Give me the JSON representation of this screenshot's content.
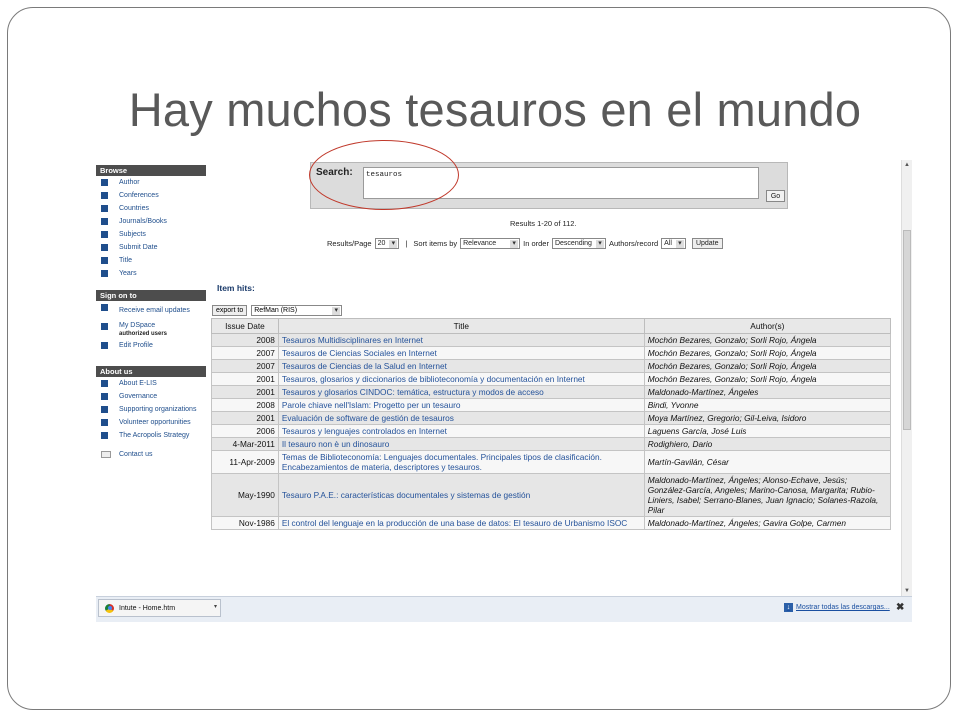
{
  "slide": {
    "title": "Hay muchos tesauros en el mundo"
  },
  "sidebar": {
    "browse_head": "Browse",
    "browse": [
      "Author",
      "Conferences",
      "Countries",
      "Journals/Books",
      "Subjects",
      "Submit Date",
      "Title",
      "Years"
    ],
    "signon_head": "Sign on to",
    "signon": [
      {
        "label": "Receive email updates"
      },
      {
        "label": "My DSpace",
        "sub": "authorized users"
      },
      {
        "label": "Edit Profile"
      }
    ],
    "about_head": "About us",
    "about": [
      "About E-LIS",
      "Governance",
      "Supporting organizations",
      "Volunteer opportunities",
      "The Acropolis Strategy"
    ],
    "contact": "Contact us"
  },
  "search": {
    "label": "Search:",
    "value": "tesauros",
    "go": "Go"
  },
  "results_summary": "Results 1-20 of 112.",
  "controls": {
    "results_per_page_label": "Results/Page",
    "results_per_page": "20",
    "sort_label": "Sort items by",
    "sort_value": "Relevance",
    "order_label": "In order",
    "order_value": "Descending",
    "authors_label": "Authors/record",
    "authors_value": "All",
    "update": "Update"
  },
  "item_hits": "Item hits:",
  "export": {
    "button": "export to",
    "format": "RefMan (RIS)"
  },
  "table": {
    "headers": [
      "Issue Date",
      "Title",
      "Author(s)"
    ],
    "rows": [
      {
        "date": "2008",
        "title": "Tesauros Multidisciplinares en Internet",
        "author": "Mochón Bezares, Gonzalo; Sorli Rojo, Ángela"
      },
      {
        "date": "2007",
        "title": "Tesauros de Ciencias Sociales en Internet",
        "author": "Mochón Bezares, Gonzalo; Sorli Rojo, Ángela"
      },
      {
        "date": "2007",
        "title": "Tesauros de Ciencias de la Salud en Internet",
        "author": "Mochón Bezares, Gonzalo; Sorli Rojo, Ángela"
      },
      {
        "date": "2001",
        "title": "Tesauros, glosarios y diccionarios de biblioteconomía y documentación en Internet",
        "author": "Mochón Bezares, Gonzalo; Sorli Rojo, Ángela"
      },
      {
        "date": "2001",
        "title": "Tesauros y glosarios CINDOC: temática, estructura y modos de acceso",
        "author": "Maldonado-Martínez, Ángeles"
      },
      {
        "date": "2008",
        "title": "Parole chiave nell'Islam: Progetto per un tesauro",
        "author": "Bindi, Yvonne"
      },
      {
        "date": "2001",
        "title": "Evaluación de software de gestión de tesauros",
        "author": "Moya Martínez, Gregorio; Gil-Leiva, Isidoro"
      },
      {
        "date": "2006",
        "title": "Tesauros y lenguajes controlados en Internet",
        "author": "Laguens García, José Luis"
      },
      {
        "date": "4-Mar-2011",
        "title": "Il tesauro non è un dinosauro",
        "author": "Rodighiero, Dario"
      },
      {
        "date": "11-Apr-2009",
        "title": "Temas de Biblioteconomía: Lenguajes documentales. Principales tipos de clasificación. Encabezamientos de materia, descriptores y tesauros.",
        "author": "Martín-Gavilán, César"
      },
      {
        "date": "May-1990",
        "title": "Tesauro P.A.E.: características documentales y sistemas de gestión",
        "author": "Maldonado-Martínez, Ángeles; Alonso-Echave, Jesús; González-García, Angeles; Marino-Canosa, Margarita; Rubio-Liniers, Isabel; Serrano-Blanes, Juan Ignacio; Solanes-Razola, Pilar"
      },
      {
        "date": "Nov-1986",
        "title": "El control del lenguaje en la producción de una base de datos: El tesauro de Urbanismo ISOC",
        "author": "Maldonado-Martínez, Ángeles; Gavira Golpe, Carmen"
      }
    ]
  },
  "download_bar": {
    "file": "Intute - Home.htm",
    "show_all": "Mostrar todas las descargas...",
    "close": "✖"
  },
  "colors": {
    "title": "#595959",
    "link": "#24529a",
    "highlight_ellipse": "#c0392b"
  }
}
